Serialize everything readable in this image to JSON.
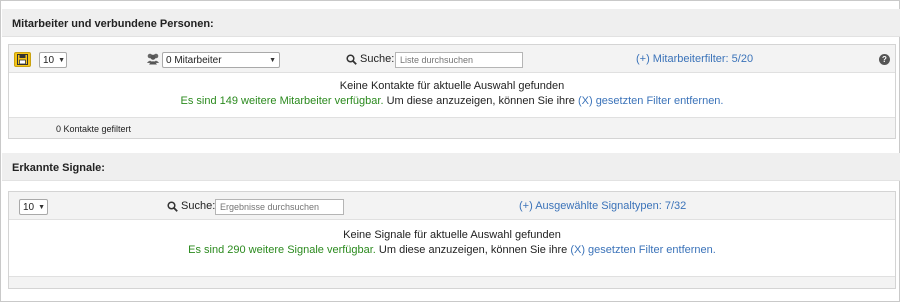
{
  "employees": {
    "title": "Mitarbeiter und verbundene Personen:",
    "page_size": "10",
    "employee_select": "0 Mitarbeiter",
    "search_label": "Suche:",
    "search_placeholder": "Liste durchsuchen",
    "filter_link": "(+) Mitarbeiterfilter: 5/20",
    "help": "?",
    "empty_message": "Keine Kontakte für aktuelle Auswahl gefunden",
    "more_green": "Es sind 149 weitere Mitarbeiter verfügbar.",
    "more_rest": " Um diese anzuzeigen, können Sie ihre ",
    "more_link": "(X) gesetzten Filter entfernen.",
    "footer": "0 Kontakte gefiltert"
  },
  "signals": {
    "title": "Erkannte Signale:",
    "page_size": "10",
    "search_label": "Suche:",
    "search_placeholder": "Ergebnisse durchsuchen",
    "filter_link": "(+) Ausgewählte Signaltypen: 7/32",
    "empty_message": "Keine Signale für aktuelle Auswahl gefunden",
    "more_green": "Es sind 290 weitere Signale verfügbar.",
    "more_rest": " Um diese anzuzeigen, können Sie ihre ",
    "more_link": "(X) gesetzten Filter entfernen."
  },
  "colors": {
    "link": "#3b73b9",
    "green_text": "#2b8a1e",
    "save_button": "#f5c518",
    "header_bg": "#efefef"
  },
  "icons": [
    "save-icon",
    "users-icon",
    "search-icon",
    "help-icon"
  ]
}
